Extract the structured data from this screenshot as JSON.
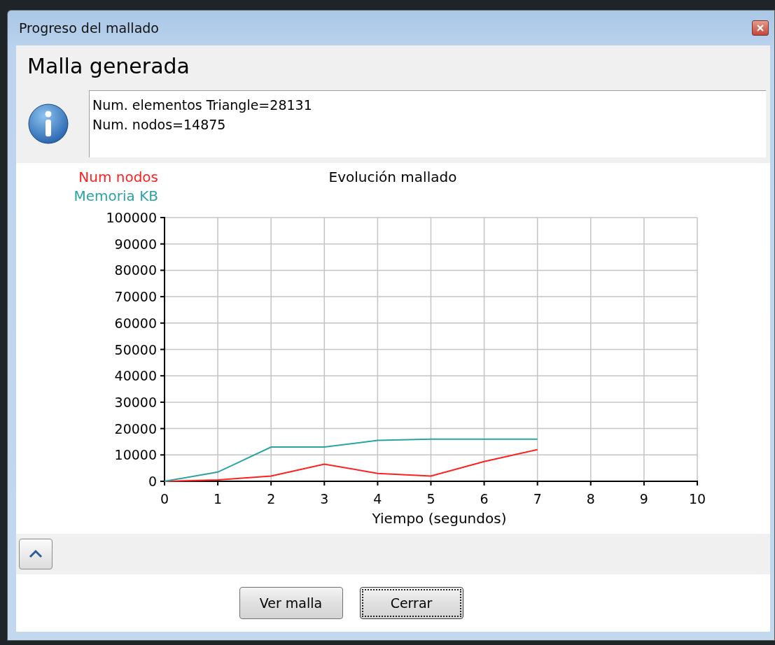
{
  "window": {
    "title": "Progreso del mallado"
  },
  "heading": "Malla generada",
  "message": {
    "lines": [
      "Num. elementos Triangle=28131",
      "Num. nodos=14875"
    ]
  },
  "chart_data": {
    "type": "line",
    "title": "Evolución mallado",
    "xlabel": "Yiempo (segundos)",
    "x": [
      0,
      1,
      2,
      3,
      4,
      5,
      6,
      7
    ],
    "series": [
      {
        "name": "Num nodos",
        "color": "#ff2020",
        "values": [
          0,
          500,
          2000,
          6500,
          3000,
          2000,
          7500,
          12000
        ]
      },
      {
        "name": "Memoria KB",
        "color": "#2aa3a3",
        "values": [
          0,
          3500,
          13000,
          13000,
          15500,
          16000,
          16000,
          16000
        ]
      }
    ],
    "grid": true,
    "xlim": [
      0,
      10
    ],
    "ylim": [
      0,
      100000
    ],
    "xticks": [
      0,
      1,
      2,
      3,
      4,
      5,
      6,
      7,
      8,
      9,
      10
    ],
    "yticks": [
      0,
      10000,
      20000,
      30000,
      40000,
      50000,
      60000,
      70000,
      80000,
      90000,
      100000
    ]
  },
  "buttons": [
    {
      "label": "Ver malla",
      "focused": false
    },
    {
      "label": "Cerrar",
      "focused": true
    }
  ]
}
